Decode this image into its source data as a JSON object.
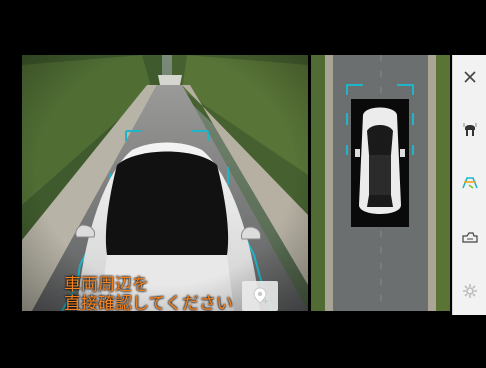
{
  "message": {
    "line1": "車両周辺を",
    "line2": "直接確認してください"
  },
  "icons": {
    "close": "close-icon",
    "front_camera": "front-camera-icon",
    "guide_lines": "guide-lines-icon",
    "camera_switch": "camera-switch-icon",
    "settings": "settings-icon",
    "location": "location-pin-icon"
  },
  "colors": {
    "message": "#f5821f",
    "guide_lines": "#1fb5c9",
    "toolbar_bg": "#f2f2f2"
  }
}
